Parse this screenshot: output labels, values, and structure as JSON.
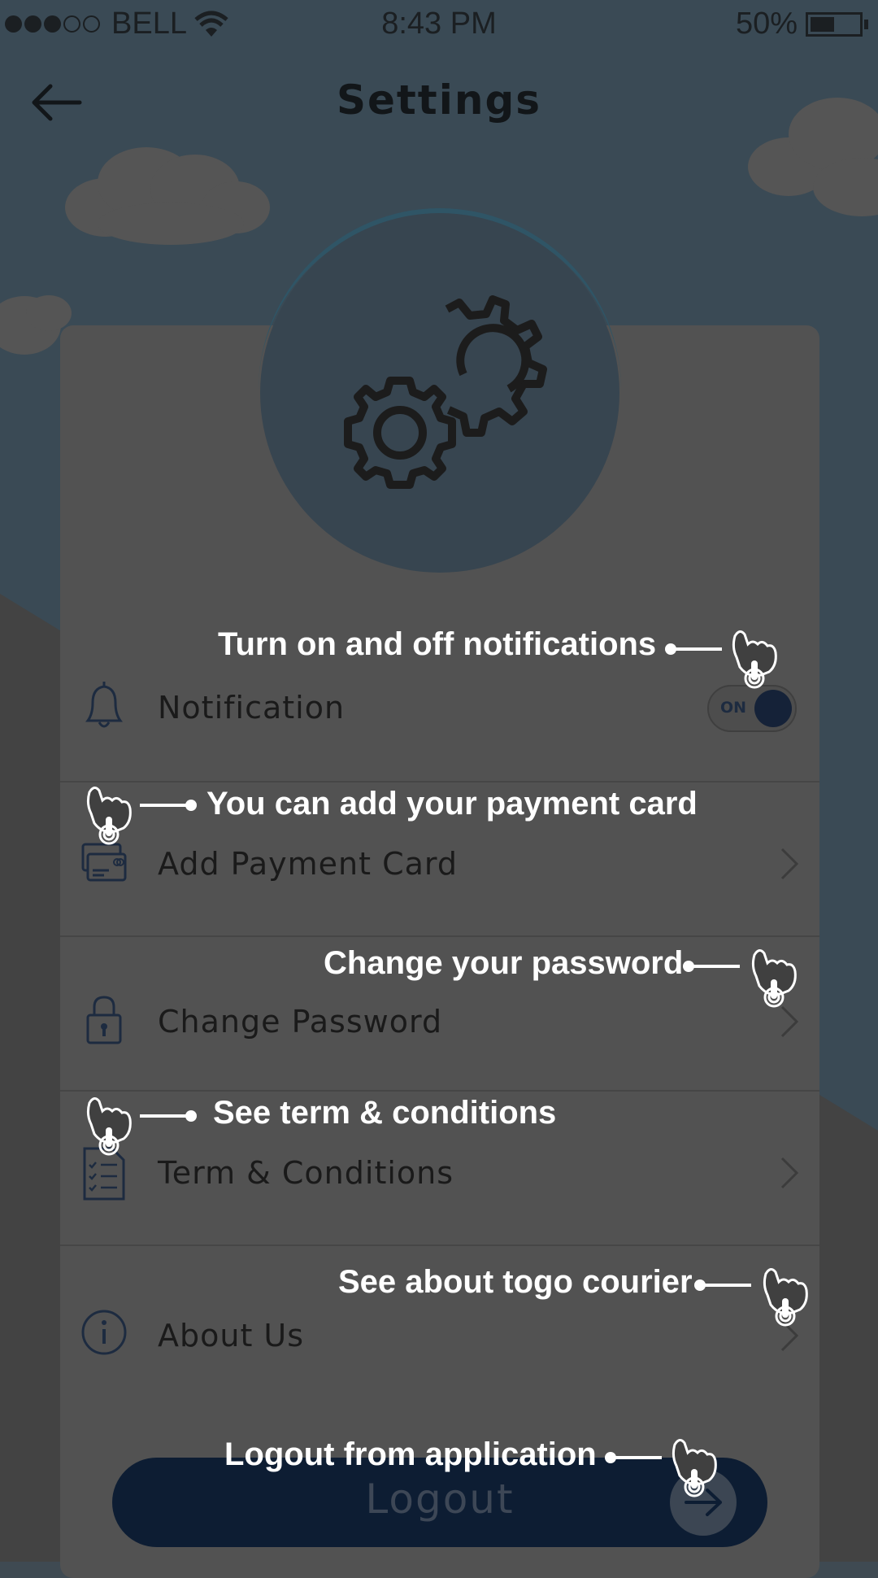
{
  "status_bar": {
    "carrier": "BELL",
    "time": "8:43 PM",
    "battery_percent_label": "50%",
    "battery_level": 0.5,
    "signal_filled": 3,
    "signal_total": 5
  },
  "header": {
    "title": "Settings",
    "back_icon": "arrow-left-icon"
  },
  "settings": {
    "items": [
      {
        "label": "Notification",
        "icon": "bell-icon",
        "control": "toggle",
        "toggle_label": "ON",
        "toggle_on": true
      },
      {
        "label": "Add Payment Card",
        "icon": "credit-card-icon",
        "control": "chevron"
      },
      {
        "label": "Change Password",
        "icon": "lock-icon",
        "control": "chevron"
      },
      {
        "label": "Term & Conditions",
        "icon": "document-checklist-icon",
        "control": "chevron"
      },
      {
        "label": "About Us",
        "icon": "info-icon",
        "control": "chevron"
      }
    ]
  },
  "logout": {
    "label": "Logout",
    "icon": "arrow-right-icon"
  },
  "coach_marks": {
    "notification": "Turn on and off notifications",
    "payment": "You can add your payment card",
    "password": "Change your password",
    "terms": "See term & conditions",
    "about": "See about togo courier",
    "logout": "Logout from application"
  },
  "colors": {
    "overlay_bg": "#3f4a52",
    "card": "#525252",
    "accent_dark_navy": "#0d1d33",
    "icon_blue": "#1d2b40",
    "coach_text": "#ffffff"
  }
}
